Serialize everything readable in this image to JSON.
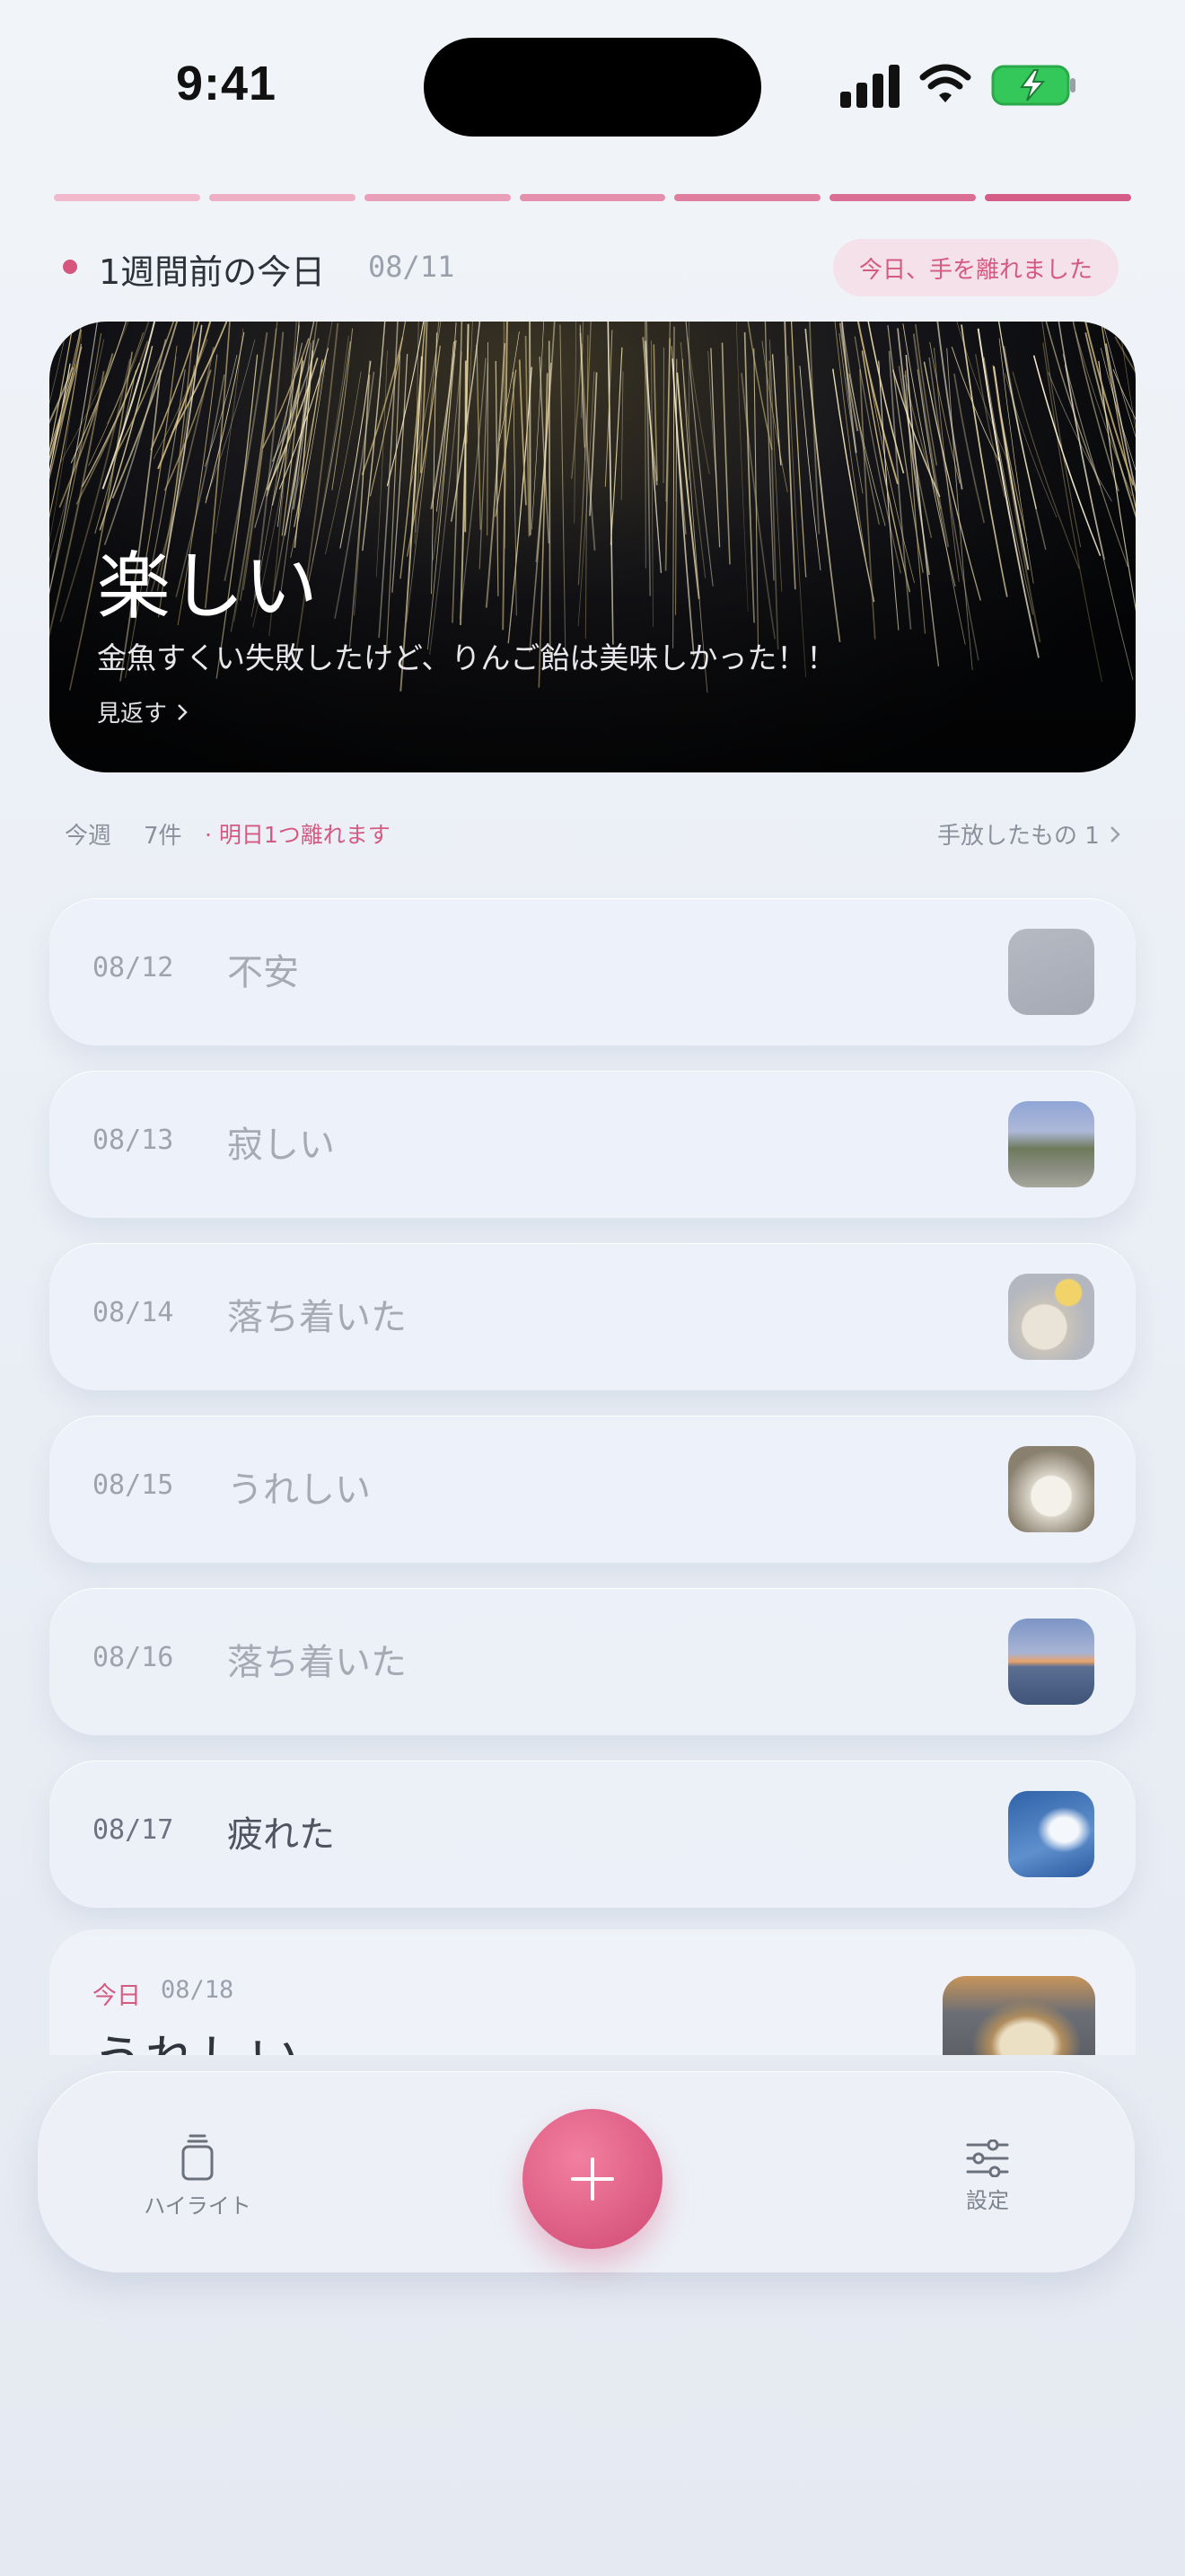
{
  "status_bar": {
    "time": "9:41"
  },
  "progress": {
    "segments": 7,
    "colors": [
      "#f2b9cc",
      "#eeaec3",
      "#ea9fb8",
      "#e58fac",
      "#e07ea0",
      "#da6d93",
      "#d45c86"
    ]
  },
  "header": {
    "title": "1週間前の今日",
    "date": "08/11",
    "pill": "今日、手を離れました"
  },
  "hero": {
    "mood": "楽しい",
    "text": "金魚すくい失敗したけど、りんご飴は美味しかった！！",
    "link": "見返す"
  },
  "summary": {
    "week_label": "今週",
    "count": "7件",
    "note": "· 明日1つ離れます",
    "released": "手放したもの 1"
  },
  "entries": [
    {
      "date": "08/12",
      "mood": "不安",
      "thumb": "gray-square-icon"
    },
    {
      "date": "08/13",
      "mood": "寂しい",
      "thumb": "mountain-road-photo-icon"
    },
    {
      "date": "08/14",
      "mood": "落ち着いた",
      "thumb": "food-plate-photo-icon"
    },
    {
      "date": "08/15",
      "mood": "うれしい",
      "thumb": "plush-toy-photo-icon"
    },
    {
      "date": "08/16",
      "mood": "落ち着いた",
      "thumb": "sunset-sea-photo-icon"
    },
    {
      "date": "08/17",
      "mood": "疲れた",
      "thumb": "blue-sky-photo-icon"
    }
  ],
  "today_entry": {
    "label": "今日",
    "date": "08/18",
    "mood": "うれしい",
    "thumb": "coffee-cup-photo-icon"
  },
  "tabbar": {
    "highlight_label": "ハイライト",
    "settings_label": "設定",
    "add_icon": "plus-icon"
  },
  "colors": {
    "accent": "#d6567e",
    "pill_bg": "#f4e1ea"
  }
}
